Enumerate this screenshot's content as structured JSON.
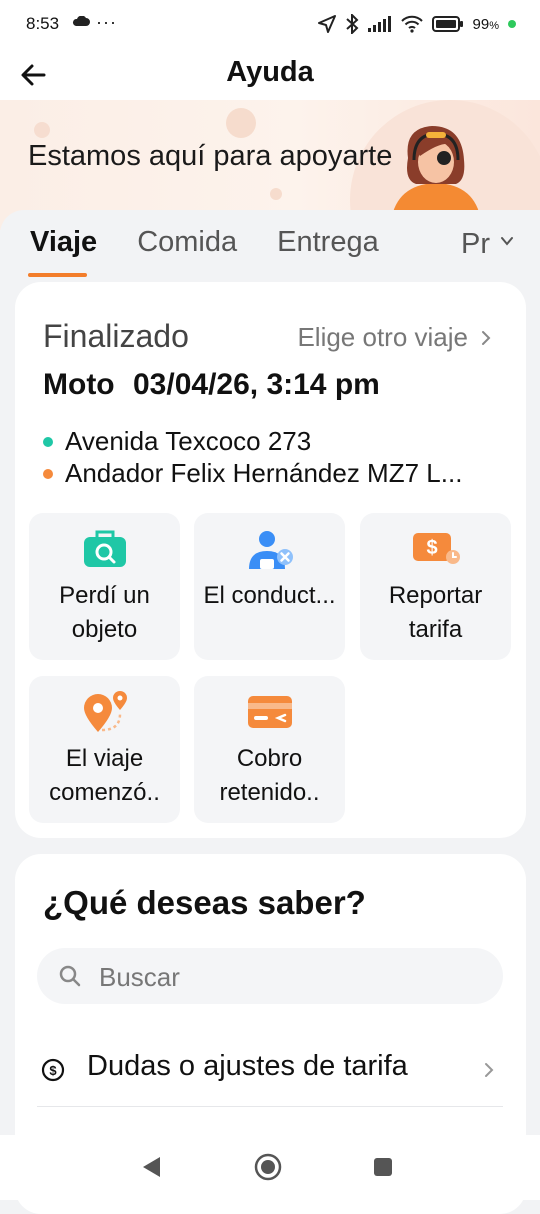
{
  "status_bar": {
    "time": "8:53",
    "more": "···",
    "battery": "99",
    "battery_unit": "%"
  },
  "header": {
    "title": "Ayuda"
  },
  "banner": {
    "text": "Estamos aquí para apoyarte"
  },
  "tabs": [
    {
      "label": "Viaje",
      "active": true
    },
    {
      "label": "Comida",
      "active": false
    },
    {
      "label": "Entrega",
      "active": false
    },
    {
      "label": "Pr",
      "active": false
    }
  ],
  "trip": {
    "status": "Finalizado",
    "other_trip": "Elige otro viaje",
    "type": "Moto",
    "datetime": "03/04/26, 3:14 pm",
    "origin": "Avenida Texcoco 273",
    "destination": "Andador Felix Hernández MZ7 L...",
    "origin_color": "#1fc7a6",
    "destination_color": "#f58a3c"
  },
  "actions": [
    {
      "label": "Perdí un objeto",
      "icon": "lost-item-icon"
    },
    {
      "label": "El conduct...",
      "icon": "driver-icon"
    },
    {
      "label": "Reportar tarifa",
      "icon": "fare-icon"
    },
    {
      "label": "El viaje comenzó..",
      "icon": "route-pin-icon"
    },
    {
      "label": "Cobro retenido..",
      "icon": "card-icon"
    }
  ],
  "faq": {
    "title": "¿Qué deseas saber?",
    "search_placeholder": "Buscar",
    "items": [
      {
        "label": "Dudas o ajustes de tarifa",
        "icon": "dollar-circle-icon"
      }
    ]
  },
  "colors": {
    "accent": "#f37d2a",
    "teal": "#1fc7a6",
    "blue": "#3a8ef6"
  }
}
